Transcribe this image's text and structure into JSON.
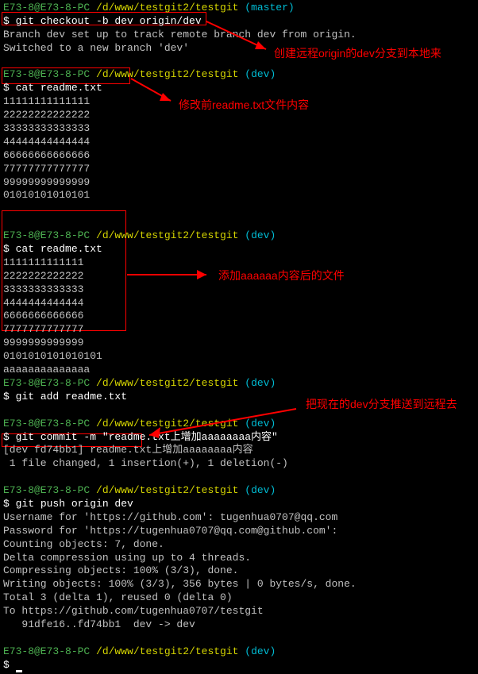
{
  "prompt1": {
    "user": "E73-8@E73-8-PC",
    "path": "/d/www/testgit2/testgit",
    "branch": "(master)"
  },
  "cmd1": "git checkout -b dev origin/dev",
  "out1_1": "Branch dev set up to track remote branch dev from origin.",
  "out1_2": "Switched to a new branch 'dev'",
  "prompt2": {
    "user": "E73-8@E73-8-PC",
    "path": "/d/www/testgit2/testgit",
    "branch": "(dev)"
  },
  "cmd2": "cat readme.txt",
  "file1": [
    "11111111111111",
    "22222222222222",
    "33333333333333",
    "44444444444444",
    "66666666666666",
    "77777777777777",
    "99999999999999",
    "01010101010101"
  ],
  "prompt3": {
    "user": "E73-8@E73-8-PC",
    "path": "/d/www/testgit2/testgit",
    "branch": "(dev)"
  },
  "cmd3": "cat readme.txt",
  "file2": [
    "1111111111111",
    "2222222222222",
    "3333333333333",
    "4444444444444",
    "6666666666666",
    "7777777777777",
    "9999999999999",
    "0101010101010101",
    "aaaaaaaaaaaaaa"
  ],
  "prompt4": {
    "user": "E73-8@E73-8-PC",
    "path": "/d/www/testgit2/testgit",
    "branch": "(dev)"
  },
  "cmd4": "git add readme.txt",
  "prompt5": {
    "user": "E73-8@E73-8-PC",
    "path": "/d/www/testgit2/testgit",
    "branch": "(dev)"
  },
  "cmd5": "git commit -m \"readme.txt上增加aaaaaaaa内容\"",
  "out5_1": "[dev fd74bb1] readme.txt上增加aaaaaaaa内容",
  "out5_2": " 1 file changed, 1 insertion(+), 1 deletion(-)",
  "prompt6": {
    "user": "E73-8@E73-8-PC",
    "path": "/d/www/testgit2/testgit",
    "branch": "(dev)"
  },
  "cmd6": "git push origin dev",
  "out6": [
    "Username for 'https://github.com': tugenhua0707@qq.com",
    "Password for 'https://tugenhua0707@qq.com@github.com':",
    "Counting objects: 7, done.",
    "Delta compression using up to 4 threads.",
    "Compressing objects: 100% (3/3), done.",
    "Writing objects: 100% (3/3), 356 bytes | 0 bytes/s, done.",
    "Total 3 (delta 1), reused 0 (delta 0)",
    "To https://github.com/tugenhua0707/testgit",
    "   91dfe16..fd74bb1  dev -> dev"
  ],
  "prompt7": {
    "user": "E73-8@E73-8-PC",
    "path": "/d/www/testgit2/testgit",
    "branch": "(dev)"
  },
  "annotations": {
    "a1": "创建远程origin的dev分支到本地来",
    "a2": "修改前readme.txt文件内容",
    "a3": "添加aaaaaa内容后的文件",
    "a4": "把现在的dev分支推送到远程去"
  }
}
